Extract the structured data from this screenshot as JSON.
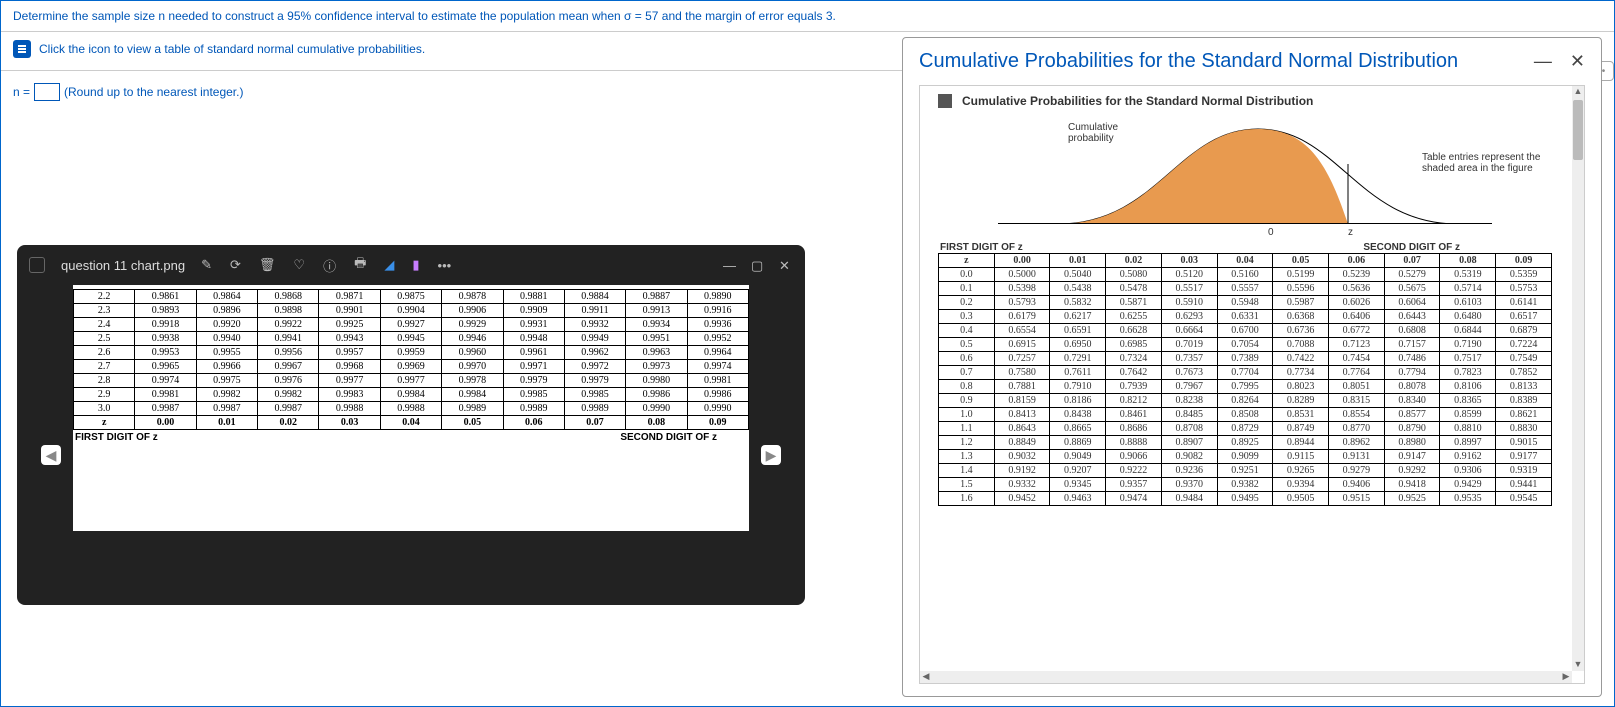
{
  "question": "Determine the sample size n needed to construct a 95% confidence interval to estimate the population mean when σ = 57 and the margin of error equals 3.",
  "link_text": "Click the icon to view a table of standard normal cumulative probabilities.",
  "divider_handle": "•••",
  "n_prefix": "n =",
  "n_hint": "(Round up to the nearest integer.)",
  "viewer": {
    "filename": "question 11 chart.png",
    "header_first": "FIRST DIGIT OF z",
    "header_second": "SECOND DIGIT OF z",
    "col_z": "z",
    "cols": [
      "0.00",
      "0.01",
      "0.02",
      "0.03",
      "0.04",
      "0.05",
      "0.06",
      "0.07",
      "0.08",
      "0.09"
    ],
    "rows": [
      {
        "z": "2.2",
        "v": [
          "0.9861",
          "0.9864",
          "0.9868",
          "0.9871",
          "0.9875",
          "0.9878",
          "0.9881",
          "0.9884",
          "0.9887",
          "0.9890"
        ]
      },
      {
        "z": "2.3",
        "v": [
          "0.9893",
          "0.9896",
          "0.9898",
          "0.9901",
          "0.9904",
          "0.9906",
          "0.9909",
          "0.9911",
          "0.9913",
          "0.9916"
        ]
      },
      {
        "z": "2.4",
        "v": [
          "0.9918",
          "0.9920",
          "0.9922",
          "0.9925",
          "0.9927",
          "0.9929",
          "0.9931",
          "0.9932",
          "0.9934",
          "0.9936"
        ]
      },
      {
        "z": "2.5",
        "v": [
          "0.9938",
          "0.9940",
          "0.9941",
          "0.9943",
          "0.9945",
          "0.9946",
          "0.9948",
          "0.9949",
          "0.9951",
          "0.9952"
        ]
      },
      {
        "z": "2.6",
        "v": [
          "0.9953",
          "0.9955",
          "0.9956",
          "0.9957",
          "0.9959",
          "0.9960",
          "0.9961",
          "0.9962",
          "0.9963",
          "0.9964"
        ]
      },
      {
        "z": "2.7",
        "v": [
          "0.9965",
          "0.9966",
          "0.9967",
          "0.9968",
          "0.9969",
          "0.9970",
          "0.9971",
          "0.9972",
          "0.9973",
          "0.9974"
        ]
      },
      {
        "z": "2.8",
        "v": [
          "0.9974",
          "0.9975",
          "0.9976",
          "0.9977",
          "0.9977",
          "0.9978",
          "0.9979",
          "0.9979",
          "0.9980",
          "0.9981"
        ]
      },
      {
        "z": "2.9",
        "v": [
          "0.9981",
          "0.9982",
          "0.9982",
          "0.9983",
          "0.9984",
          "0.9984",
          "0.9985",
          "0.9985",
          "0.9986",
          "0.9986"
        ]
      },
      {
        "z": "3.0",
        "v": [
          "0.9987",
          "0.9987",
          "0.9987",
          "0.9988",
          "0.9988",
          "0.9989",
          "0.9989",
          "0.9989",
          "0.9990",
          "0.9990"
        ]
      }
    ]
  },
  "popup": {
    "title": "Cumulative Probabilities for the Standard Normal Distribution",
    "subtitle": "Cumulative Probabilities for the Standard Normal Distribution",
    "curve_label_left": "Cumulative\nprobability",
    "curve_label_right": "Table entries represent the shaded area in the figure",
    "tick0": "0",
    "tickz": "z",
    "header_first": "FIRST DIGIT OF z",
    "header_second": "SECOND DIGIT OF z",
    "col_z": "z",
    "cols": [
      "0.00",
      "0.01",
      "0.02",
      "0.03",
      "0.04",
      "0.05",
      "0.06",
      "0.07",
      "0.08",
      "0.09"
    ],
    "rows": [
      {
        "z": "0.0",
        "v": [
          "0.5000",
          "0.5040",
          "0.5080",
          "0.5120",
          "0.5160",
          "0.5199",
          "0.5239",
          "0.5279",
          "0.5319",
          "0.5359"
        ]
      },
      {
        "z": "0.1",
        "v": [
          "0.5398",
          "0.5438",
          "0.5478",
          "0.5517",
          "0.5557",
          "0.5596",
          "0.5636",
          "0.5675",
          "0.5714",
          "0.5753"
        ]
      },
      {
        "z": "0.2",
        "v": [
          "0.5793",
          "0.5832",
          "0.5871",
          "0.5910",
          "0.5948",
          "0.5987",
          "0.6026",
          "0.6064",
          "0.6103",
          "0.6141"
        ]
      },
      {
        "z": "0.3",
        "v": [
          "0.6179",
          "0.6217",
          "0.6255",
          "0.6293",
          "0.6331",
          "0.6368",
          "0.6406",
          "0.6443",
          "0.6480",
          "0.6517"
        ]
      },
      {
        "z": "0.4",
        "v": [
          "0.6554",
          "0.6591",
          "0.6628",
          "0.6664",
          "0.6700",
          "0.6736",
          "0.6772",
          "0.6808",
          "0.6844",
          "0.6879"
        ]
      },
      {
        "z": "0.5",
        "v": [
          "0.6915",
          "0.6950",
          "0.6985",
          "0.7019",
          "0.7054",
          "0.7088",
          "0.7123",
          "0.7157",
          "0.7190",
          "0.7224"
        ]
      },
      {
        "z": "0.6",
        "v": [
          "0.7257",
          "0.7291",
          "0.7324",
          "0.7357",
          "0.7389",
          "0.7422",
          "0.7454",
          "0.7486",
          "0.7517",
          "0.7549"
        ]
      },
      {
        "z": "0.7",
        "v": [
          "0.7580",
          "0.7611",
          "0.7642",
          "0.7673",
          "0.7704",
          "0.7734",
          "0.7764",
          "0.7794",
          "0.7823",
          "0.7852"
        ]
      },
      {
        "z": "0.8",
        "v": [
          "0.7881",
          "0.7910",
          "0.7939",
          "0.7967",
          "0.7995",
          "0.8023",
          "0.8051",
          "0.8078",
          "0.8106",
          "0.8133"
        ]
      },
      {
        "z": "0.9",
        "v": [
          "0.8159",
          "0.8186",
          "0.8212",
          "0.8238",
          "0.8264",
          "0.8289",
          "0.8315",
          "0.8340",
          "0.8365",
          "0.8389"
        ]
      },
      {
        "z": "1.0",
        "v": [
          "0.8413",
          "0.8438",
          "0.8461",
          "0.8485",
          "0.8508",
          "0.8531",
          "0.8554",
          "0.8577",
          "0.8599",
          "0.8621"
        ]
      },
      {
        "z": "1.1",
        "v": [
          "0.8643",
          "0.8665",
          "0.8686",
          "0.8708",
          "0.8729",
          "0.8749",
          "0.8770",
          "0.8790",
          "0.8810",
          "0.8830"
        ]
      },
      {
        "z": "1.2",
        "v": [
          "0.8849",
          "0.8869",
          "0.8888",
          "0.8907",
          "0.8925",
          "0.8944",
          "0.8962",
          "0.8980",
          "0.8997",
          "0.9015"
        ]
      },
      {
        "z": "1.3",
        "v": [
          "0.9032",
          "0.9049",
          "0.9066",
          "0.9082",
          "0.9099",
          "0.9115",
          "0.9131",
          "0.9147",
          "0.9162",
          "0.9177"
        ]
      },
      {
        "z": "1.4",
        "v": [
          "0.9192",
          "0.9207",
          "0.9222",
          "0.9236",
          "0.9251",
          "0.9265",
          "0.9279",
          "0.9292",
          "0.9306",
          "0.9319"
        ]
      },
      {
        "z": "1.5",
        "v": [
          "0.9332",
          "0.9345",
          "0.9357",
          "0.9370",
          "0.9382",
          "0.9394",
          "0.9406",
          "0.9418",
          "0.9429",
          "0.9441"
        ]
      },
      {
        "z": "1.6",
        "v": [
          "0.9452",
          "0.9463",
          "0.9474",
          "0.9484",
          "0.9495",
          "0.9505",
          "0.9515",
          "0.9525",
          "0.9535",
          "0.9545"
        ]
      }
    ]
  },
  "chart_data": {
    "type": "table",
    "title": "Cumulative Probabilities for the Standard Normal Distribution",
    "row_header": "FIRST DIGIT OF z",
    "col_header": "SECOND DIGIT OF z",
    "columns": [
      "0.00",
      "0.01",
      "0.02",
      "0.03",
      "0.04",
      "0.05",
      "0.06",
      "0.07",
      "0.08",
      "0.09"
    ],
    "z_values": [
      "0.0",
      "0.1",
      "0.2",
      "0.3",
      "0.4",
      "0.5",
      "0.6",
      "0.7",
      "0.8",
      "0.9",
      "1.0",
      "1.1",
      "1.2",
      "1.3",
      "1.4",
      "1.5",
      "1.6"
    ],
    "data": [
      [
        0.5,
        0.504,
        0.508,
        0.512,
        0.516,
        0.5199,
        0.5239,
        0.5279,
        0.5319,
        0.5359
      ],
      [
        0.5398,
        0.5438,
        0.5478,
        0.5517,
        0.5557,
        0.5596,
        0.5636,
        0.5675,
        0.5714,
        0.5753
      ],
      [
        0.5793,
        0.5832,
        0.5871,
        0.591,
        0.5948,
        0.5987,
        0.6026,
        0.6064,
        0.6103,
        0.6141
      ],
      [
        0.6179,
        0.6217,
        0.6255,
        0.6293,
        0.6331,
        0.6368,
        0.6406,
        0.6443,
        0.648,
        0.6517
      ],
      [
        0.6554,
        0.6591,
        0.6628,
        0.6664,
        0.67,
        0.6736,
        0.6772,
        0.6808,
        0.6844,
        0.6879
      ],
      [
        0.6915,
        0.695,
        0.6985,
        0.7019,
        0.7054,
        0.7088,
        0.7123,
        0.7157,
        0.719,
        0.7224
      ],
      [
        0.7257,
        0.7291,
        0.7324,
        0.7357,
        0.7389,
        0.7422,
        0.7454,
        0.7486,
        0.7517,
        0.7549
      ],
      [
        0.758,
        0.7611,
        0.7642,
        0.7673,
        0.7704,
        0.7734,
        0.7764,
        0.7794,
        0.7823,
        0.7852
      ],
      [
        0.7881,
        0.791,
        0.7939,
        0.7967,
        0.7995,
        0.8023,
        0.8051,
        0.8078,
        0.8106,
        0.8133
      ],
      [
        0.8159,
        0.8186,
        0.8212,
        0.8238,
        0.8264,
        0.8289,
        0.8315,
        0.834,
        0.8365,
        0.8389
      ],
      [
        0.8413,
        0.8438,
        0.8461,
        0.8485,
        0.8508,
        0.8531,
        0.8554,
        0.8577,
        0.8599,
        0.8621
      ],
      [
        0.8643,
        0.8665,
        0.8686,
        0.8708,
        0.8729,
        0.8749,
        0.877,
        0.879,
        0.881,
        0.883
      ],
      [
        0.8849,
        0.8869,
        0.8888,
        0.8907,
        0.8925,
        0.8944,
        0.8962,
        0.898,
        0.8997,
        0.9015
      ],
      [
        0.9032,
        0.9049,
        0.9066,
        0.9082,
        0.9099,
        0.9115,
        0.9131,
        0.9147,
        0.9162,
        0.9177
      ],
      [
        0.9192,
        0.9207,
        0.9222,
        0.9236,
        0.9251,
        0.9265,
        0.9279,
        0.9292,
        0.9306,
        0.9319
      ],
      [
        0.9332,
        0.9345,
        0.9357,
        0.937,
        0.9382,
        0.9394,
        0.9406,
        0.9418,
        0.9429,
        0.9441
      ],
      [
        0.9452,
        0.9463,
        0.9474,
        0.9484,
        0.9495,
        0.9505,
        0.9515,
        0.9525,
        0.9535,
        0.9545
      ]
    ]
  }
}
